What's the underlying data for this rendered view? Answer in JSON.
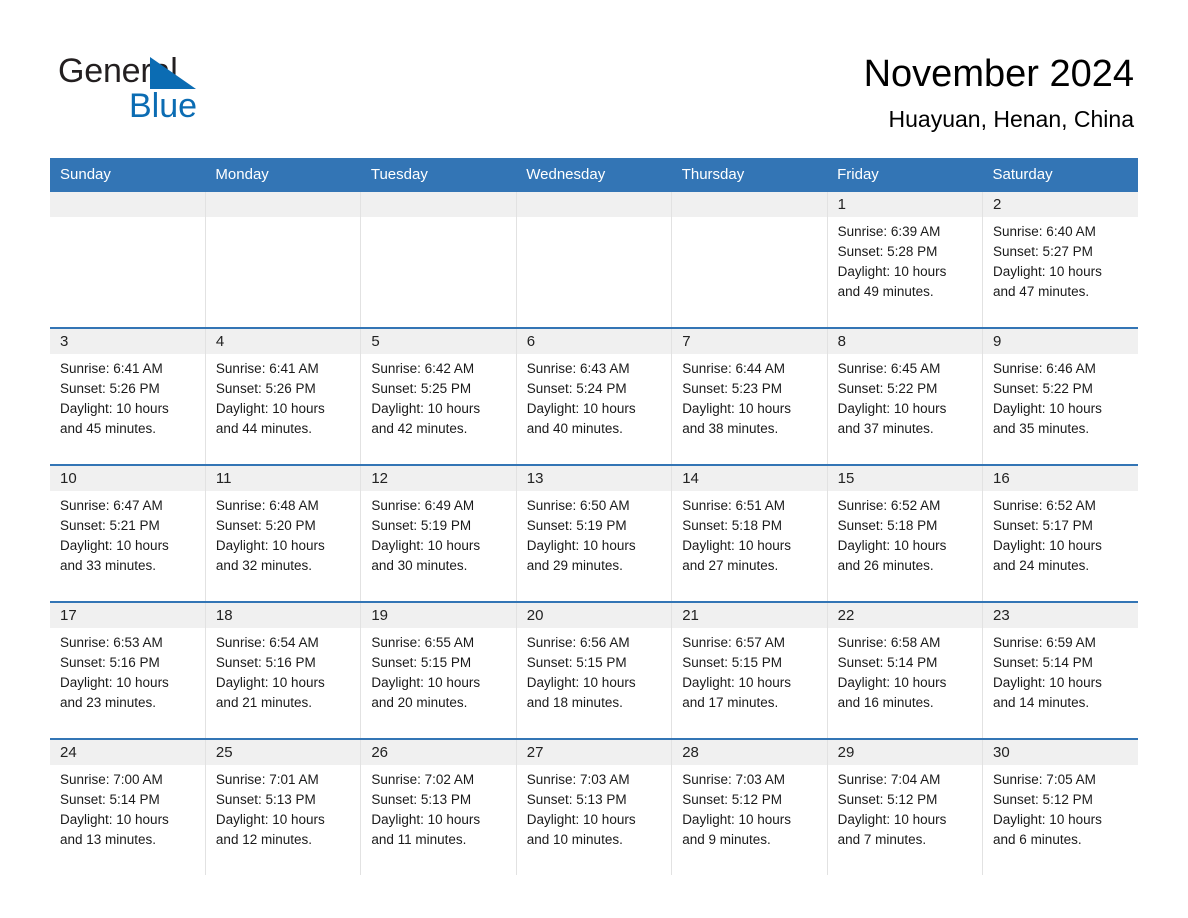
{
  "brand": {
    "name_part1": "General",
    "name_part2": "Blue",
    "triangle_icon": "triangle-icon",
    "accent_color": "#0b6cb3"
  },
  "header": {
    "title": "November 2024",
    "subtitle": "Huayuan, Henan, China"
  },
  "theme": {
    "header_blue": "#3375b5",
    "daynum_gray": "#f0f0f0",
    "row_rule": "#3375b5"
  },
  "weekdays": [
    "Sunday",
    "Monday",
    "Tuesday",
    "Wednesday",
    "Thursday",
    "Friday",
    "Saturday"
  ],
  "labels": {
    "sunrise_prefix": "Sunrise: ",
    "sunset_prefix": "Sunset: ",
    "daylight_prefix": "Daylight: "
  },
  "weeks": [
    [
      {
        "day": "",
        "empty": true
      },
      {
        "day": "",
        "empty": true
      },
      {
        "day": "",
        "empty": true
      },
      {
        "day": "",
        "empty": true
      },
      {
        "day": "",
        "empty": true
      },
      {
        "day": "1",
        "sunrise": "Sunrise: 6:39 AM",
        "sunset": "Sunset: 5:28 PM",
        "daylight_line1": "Daylight: 10 hours",
        "daylight_line2": "and 49 minutes."
      },
      {
        "day": "2",
        "sunrise": "Sunrise: 6:40 AM",
        "sunset": "Sunset: 5:27 PM",
        "daylight_line1": "Daylight: 10 hours",
        "daylight_line2": "and 47 minutes."
      }
    ],
    [
      {
        "day": "3",
        "sunrise": "Sunrise: 6:41 AM",
        "sunset": "Sunset: 5:26 PM",
        "daylight_line1": "Daylight: 10 hours",
        "daylight_line2": "and 45 minutes."
      },
      {
        "day": "4",
        "sunrise": "Sunrise: 6:41 AM",
        "sunset": "Sunset: 5:26 PM",
        "daylight_line1": "Daylight: 10 hours",
        "daylight_line2": "and 44 minutes."
      },
      {
        "day": "5",
        "sunrise": "Sunrise: 6:42 AM",
        "sunset": "Sunset: 5:25 PM",
        "daylight_line1": "Daylight: 10 hours",
        "daylight_line2": "and 42 minutes."
      },
      {
        "day": "6",
        "sunrise": "Sunrise: 6:43 AM",
        "sunset": "Sunset: 5:24 PM",
        "daylight_line1": "Daylight: 10 hours",
        "daylight_line2": "and 40 minutes."
      },
      {
        "day": "7",
        "sunrise": "Sunrise: 6:44 AM",
        "sunset": "Sunset: 5:23 PM",
        "daylight_line1": "Daylight: 10 hours",
        "daylight_line2": "and 38 minutes."
      },
      {
        "day": "8",
        "sunrise": "Sunrise: 6:45 AM",
        "sunset": "Sunset: 5:22 PM",
        "daylight_line1": "Daylight: 10 hours",
        "daylight_line2": "and 37 minutes."
      },
      {
        "day": "9",
        "sunrise": "Sunrise: 6:46 AM",
        "sunset": "Sunset: 5:22 PM",
        "daylight_line1": "Daylight: 10 hours",
        "daylight_line2": "and 35 minutes."
      }
    ],
    [
      {
        "day": "10",
        "sunrise": "Sunrise: 6:47 AM",
        "sunset": "Sunset: 5:21 PM",
        "daylight_line1": "Daylight: 10 hours",
        "daylight_line2": "and 33 minutes."
      },
      {
        "day": "11",
        "sunrise": "Sunrise: 6:48 AM",
        "sunset": "Sunset: 5:20 PM",
        "daylight_line1": "Daylight: 10 hours",
        "daylight_line2": "and 32 minutes."
      },
      {
        "day": "12",
        "sunrise": "Sunrise: 6:49 AM",
        "sunset": "Sunset: 5:19 PM",
        "daylight_line1": "Daylight: 10 hours",
        "daylight_line2": "and 30 minutes."
      },
      {
        "day": "13",
        "sunrise": "Sunrise: 6:50 AM",
        "sunset": "Sunset: 5:19 PM",
        "daylight_line1": "Daylight: 10 hours",
        "daylight_line2": "and 29 minutes."
      },
      {
        "day": "14",
        "sunrise": "Sunrise: 6:51 AM",
        "sunset": "Sunset: 5:18 PM",
        "daylight_line1": "Daylight: 10 hours",
        "daylight_line2": "and 27 minutes."
      },
      {
        "day": "15",
        "sunrise": "Sunrise: 6:52 AM",
        "sunset": "Sunset: 5:18 PM",
        "daylight_line1": "Daylight: 10 hours",
        "daylight_line2": "and 26 minutes."
      },
      {
        "day": "16",
        "sunrise": "Sunrise: 6:52 AM",
        "sunset": "Sunset: 5:17 PM",
        "daylight_line1": "Daylight: 10 hours",
        "daylight_line2": "and 24 minutes."
      }
    ],
    [
      {
        "day": "17",
        "sunrise": "Sunrise: 6:53 AM",
        "sunset": "Sunset: 5:16 PM",
        "daylight_line1": "Daylight: 10 hours",
        "daylight_line2": "and 23 minutes."
      },
      {
        "day": "18",
        "sunrise": "Sunrise: 6:54 AM",
        "sunset": "Sunset: 5:16 PM",
        "daylight_line1": "Daylight: 10 hours",
        "daylight_line2": "and 21 minutes."
      },
      {
        "day": "19",
        "sunrise": "Sunrise: 6:55 AM",
        "sunset": "Sunset: 5:15 PM",
        "daylight_line1": "Daylight: 10 hours",
        "daylight_line2": "and 20 minutes."
      },
      {
        "day": "20",
        "sunrise": "Sunrise: 6:56 AM",
        "sunset": "Sunset: 5:15 PM",
        "daylight_line1": "Daylight: 10 hours",
        "daylight_line2": "and 18 minutes."
      },
      {
        "day": "21",
        "sunrise": "Sunrise: 6:57 AM",
        "sunset": "Sunset: 5:15 PM",
        "daylight_line1": "Daylight: 10 hours",
        "daylight_line2": "and 17 minutes."
      },
      {
        "day": "22",
        "sunrise": "Sunrise: 6:58 AM",
        "sunset": "Sunset: 5:14 PM",
        "daylight_line1": "Daylight: 10 hours",
        "daylight_line2": "and 16 minutes."
      },
      {
        "day": "23",
        "sunrise": "Sunrise: 6:59 AM",
        "sunset": "Sunset: 5:14 PM",
        "daylight_line1": "Daylight: 10 hours",
        "daylight_line2": "and 14 minutes."
      }
    ],
    [
      {
        "day": "24",
        "sunrise": "Sunrise: 7:00 AM",
        "sunset": "Sunset: 5:14 PM",
        "daylight_line1": "Daylight: 10 hours",
        "daylight_line2": "and 13 minutes."
      },
      {
        "day": "25",
        "sunrise": "Sunrise: 7:01 AM",
        "sunset": "Sunset: 5:13 PM",
        "daylight_line1": "Daylight: 10 hours",
        "daylight_line2": "and 12 minutes."
      },
      {
        "day": "26",
        "sunrise": "Sunrise: 7:02 AM",
        "sunset": "Sunset: 5:13 PM",
        "daylight_line1": "Daylight: 10 hours",
        "daylight_line2": "and 11 minutes."
      },
      {
        "day": "27",
        "sunrise": "Sunrise: 7:03 AM",
        "sunset": "Sunset: 5:13 PM",
        "daylight_line1": "Daylight: 10 hours",
        "daylight_line2": "and 10 minutes."
      },
      {
        "day": "28",
        "sunrise": "Sunrise: 7:03 AM",
        "sunset": "Sunset: 5:12 PM",
        "daylight_line1": "Daylight: 10 hours",
        "daylight_line2": "and 9 minutes."
      },
      {
        "day": "29",
        "sunrise": "Sunrise: 7:04 AM",
        "sunset": "Sunset: 5:12 PM",
        "daylight_line1": "Daylight: 10 hours",
        "daylight_line2": "and 7 minutes."
      },
      {
        "day": "30",
        "sunrise": "Sunrise: 7:05 AM",
        "sunset": "Sunset: 5:12 PM",
        "daylight_line1": "Daylight: 10 hours",
        "daylight_line2": "and 6 minutes."
      }
    ]
  ]
}
